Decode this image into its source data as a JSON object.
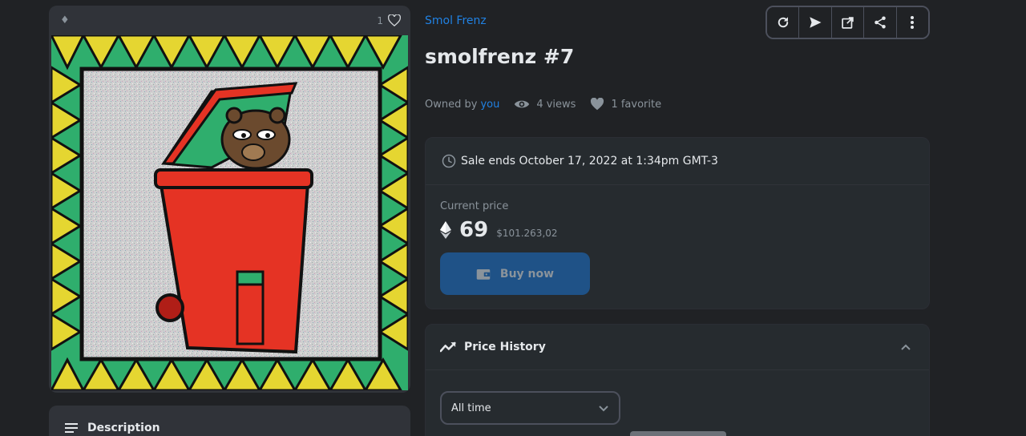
{
  "media": {
    "chain_icon": "ethereum-icon",
    "favorite_count": "1",
    "image_alt": "Pepe-style bear in a red trash bin"
  },
  "description": {
    "label": "Description"
  },
  "collection": {
    "name": "Smol Frenz"
  },
  "item": {
    "title": "smolfrenz #7"
  },
  "stats": {
    "owned_by": "Owned by",
    "owner": "you",
    "views": "4 views",
    "favorites": "1 favorite"
  },
  "toolbar": {
    "buttons": [
      "refresh-icon",
      "transfer-icon",
      "external-link-icon",
      "share-icon",
      "more-icon"
    ]
  },
  "sale": {
    "ends": "Sale ends October 17, 2022 at 1:34pm GMT-3",
    "current_price_label": "Current price",
    "price": "69",
    "price_usd": "$101.263,02",
    "buy_label": "Buy now"
  },
  "price_history": {
    "title": "Price History",
    "filter_value": "All time"
  },
  "colors": {
    "accent": "#2081e2",
    "background": "#202225",
    "card": "#262b2f",
    "buy_button": "#1f5287"
  }
}
